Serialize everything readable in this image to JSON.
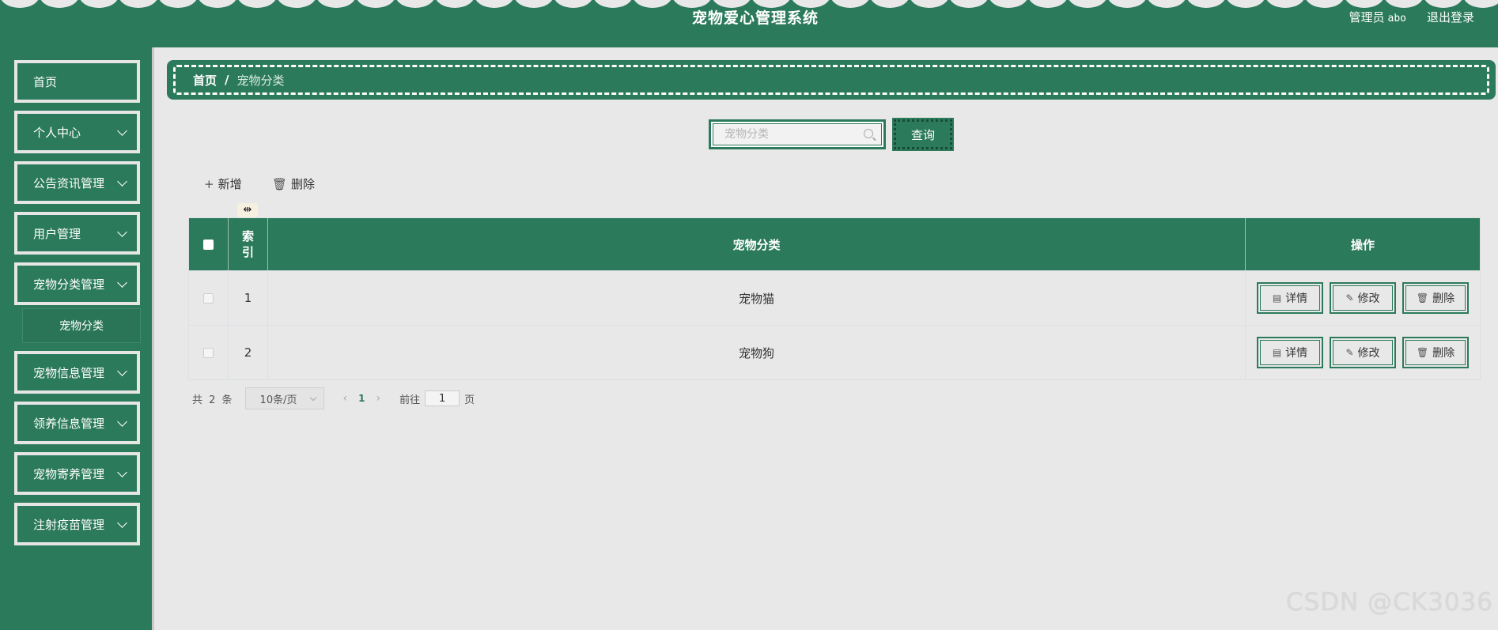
{
  "header": {
    "title": "宠物爱心管理系统",
    "user_role": "管理员",
    "user_name": "abo",
    "logout_label": "退出登录"
  },
  "sidebar": {
    "items": [
      {
        "label": "首页",
        "has_arrow": false
      },
      {
        "label": "个人中心",
        "has_arrow": true
      },
      {
        "label": "公告资讯管理",
        "has_arrow": true
      },
      {
        "label": "用户管理",
        "has_arrow": true
      },
      {
        "label": "宠物分类管理",
        "has_arrow": true
      },
      {
        "label": "宠物信息管理",
        "has_arrow": true
      },
      {
        "label": "领养信息管理",
        "has_arrow": true
      },
      {
        "label": "宠物寄养管理",
        "has_arrow": true
      },
      {
        "label": "注射疫苗管理",
        "has_arrow": true
      }
    ],
    "submenu_label": "宠物分类"
  },
  "breadcrumb": {
    "home": "首页",
    "separator": "/",
    "current": "宠物分类"
  },
  "search": {
    "placeholder": "宠物分类",
    "value": "",
    "button_label": "查询"
  },
  "actions": {
    "add_label": "新增",
    "delete_label": "删除"
  },
  "table": {
    "headers": {
      "index_line1": "索",
      "index_line2": "引",
      "name": "宠物分类",
      "ops": "操作"
    },
    "rows": [
      {
        "index": "1",
        "name": "宠物猫"
      },
      {
        "index": "2",
        "name": "宠物狗"
      }
    ],
    "row_buttons": {
      "detail": "详情",
      "edit": "修改",
      "delete": "删除"
    }
  },
  "pagination": {
    "total_text": "共 2 条",
    "page_size": "10条/页",
    "current_page": "1",
    "goto_prefix": "前往",
    "goto_value": "1",
    "goto_suffix": "页"
  },
  "watermark": "CSDN @CK3036",
  "colors": {
    "primary_green": "#2c7a5c",
    "background": "#e8e8e8"
  }
}
